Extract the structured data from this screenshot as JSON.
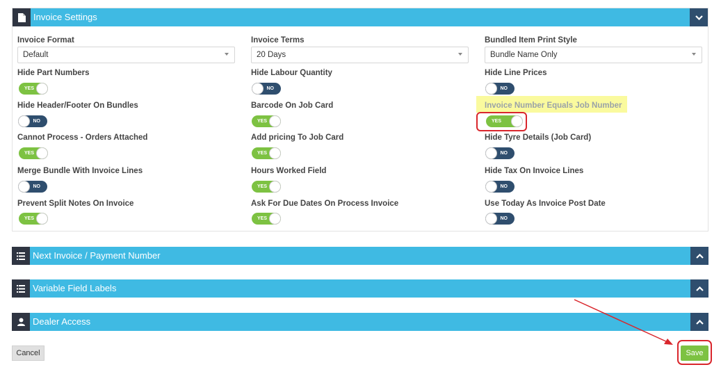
{
  "invoice_settings": {
    "title": "Invoice Settings",
    "icon": "document-icon",
    "toggle_icon": "chevron-down-icon",
    "fields": {
      "invoice_format": {
        "label": "Invoice Format",
        "value": "Default"
      },
      "invoice_terms": {
        "label": "Invoice Terms",
        "value": "20 Days"
      },
      "bundled_item_print_style": {
        "label": "Bundled Item Print Style",
        "value": "Bundle Name Only"
      }
    },
    "toggles": {
      "hide_part_numbers": {
        "label": "Hide Part Numbers",
        "state": "YES"
      },
      "hide_labour_quantity": {
        "label": "Hide Labour Quantity",
        "state": "NO"
      },
      "hide_line_prices": {
        "label": "Hide Line Prices",
        "state": "NO"
      },
      "hide_header_footer_on_bundles": {
        "label": "Hide Header/Footer On Bundles",
        "state": "NO"
      },
      "barcode_on_job_card": {
        "label": "Barcode On Job Card",
        "state": "YES"
      },
      "invoice_number_equals_job_number": {
        "label": "Invoice Number Equals Job Number",
        "state": "YES"
      },
      "cannot_process_orders_attached": {
        "label": "Cannot Process - Orders Attached",
        "state": "YES"
      },
      "add_pricing_to_job_card": {
        "label": "Add pricing To Job Card",
        "state": "YES"
      },
      "hide_tyre_details": {
        "label": "Hide Tyre Details (Job Card)",
        "state": "NO"
      },
      "merge_bundle_with_invoice_lines": {
        "label": "Merge Bundle With Invoice Lines",
        "state": "NO"
      },
      "hours_worked_field": {
        "label": "Hours Worked Field",
        "state": "YES"
      },
      "hide_tax_on_invoice_lines": {
        "label": "Hide Tax On Invoice Lines",
        "state": "NO"
      },
      "prevent_split_notes_on_invoice": {
        "label": "Prevent Split Notes On Invoice",
        "state": "YES"
      },
      "ask_for_due_dates": {
        "label": "Ask For Due Dates On Process Invoice",
        "state": "YES"
      },
      "use_today_as_invoice_post_date": {
        "label": "Use Today As Invoice Post Date",
        "state": "NO"
      }
    }
  },
  "sections": {
    "next_invoice": {
      "title": "Next Invoice / Payment Number",
      "icon": "list-icon",
      "toggle_icon": "chevron-up-icon"
    },
    "variable_field_labels": {
      "title": "Variable Field Labels",
      "icon": "list-icon",
      "toggle_icon": "chevron-up-icon"
    },
    "dealer_access": {
      "title": "Dealer Access",
      "icon": "user-icon",
      "toggle_icon": "chevron-up-icon"
    }
  },
  "actions": {
    "cancel_label": "Cancel",
    "save_label": "Save"
  },
  "colors": {
    "header_blue": "#3fbae3",
    "dark_navy": "#2f3542",
    "toggle_on": "#7dc242",
    "toggle_off": "#2f4e6e",
    "annotation_red": "#d9262c",
    "highlight_yellow": "#fafa9e"
  }
}
